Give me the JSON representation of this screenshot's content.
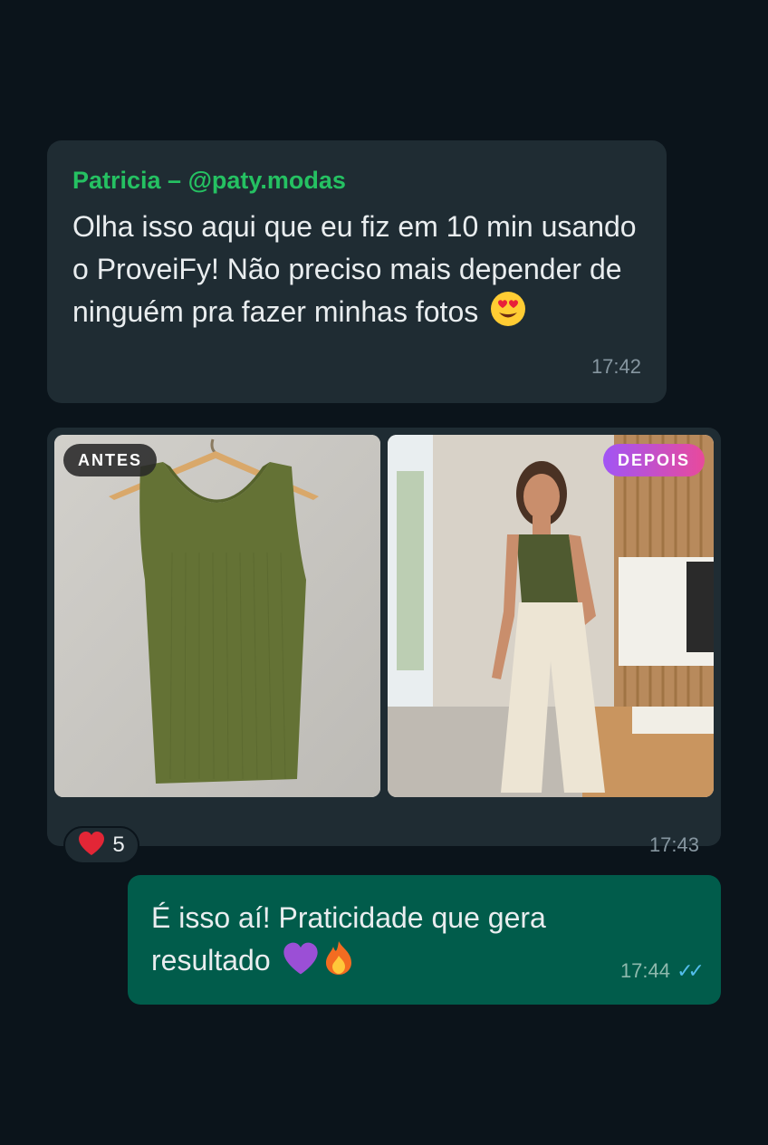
{
  "messages": [
    {
      "sender": "Patricia – @paty.modas",
      "text": "Olha isso aqui que eu fiz em 10 min usando o ProveiFy! Não preciso mais depender de ninguém pra fazer minhas fotos",
      "emoji": "heart-eyes-emoji",
      "time": "17:42"
    },
    {
      "image_left_tag": "ANTES",
      "image_right_tag": "DEPOIS",
      "time": "17:43",
      "reaction": {
        "emoji": "red-heart",
        "count": "5"
      }
    },
    {
      "text": "É isso aí! Praticidade que gera resultado",
      "emojis": [
        "purple-heart",
        "fire"
      ],
      "time": "17:44",
      "status": "✓✓"
    }
  ],
  "colors": {
    "background": "#0b141b",
    "incoming_bubble": "#1f2c33",
    "outgoing_bubble": "#015c4b",
    "sender_name": "#25c162",
    "read_ticks": "#53bdeb",
    "depois_gradient": [
      "#a155f5",
      "#e84a9c"
    ]
  }
}
